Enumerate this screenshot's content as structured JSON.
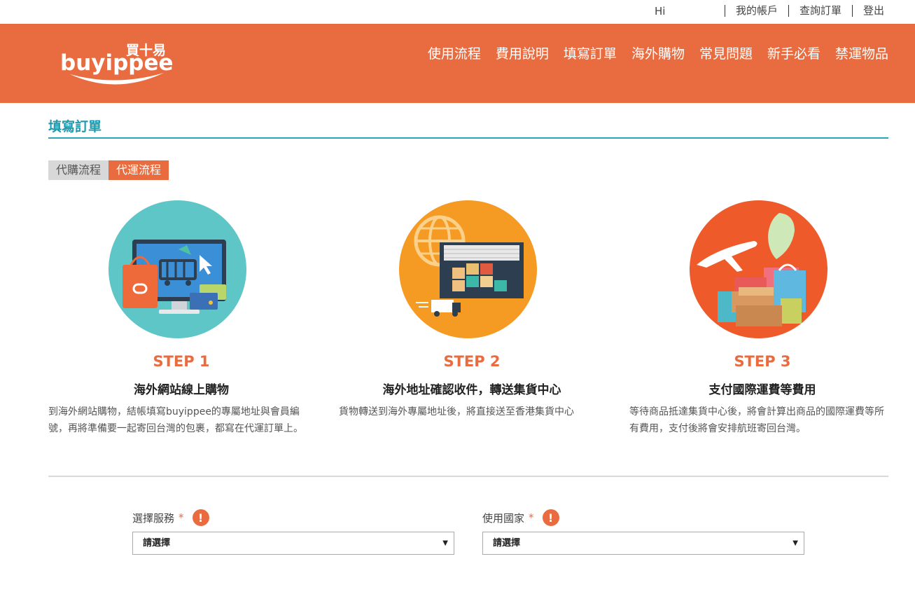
{
  "topbar": {
    "greeting": "Hi",
    "links": [
      "我的帳戶",
      "查詢訂單",
      "登出"
    ]
  },
  "header": {
    "logo_text": "buyippee",
    "logo_cn": "買十易",
    "nav": [
      "使用流程",
      "費用說明",
      "填寫訂單",
      "海外購物",
      "常見問題",
      "新手必看",
      "禁運物品"
    ],
    "bg_color": "#e96c40"
  },
  "page": {
    "title": "填寫訂單",
    "tabs": [
      {
        "label": "代購流程",
        "active": false
      },
      {
        "label": "代運流程",
        "active": true
      }
    ]
  },
  "steps": [
    {
      "number": "STEP 1",
      "title": "海外網站線上購物",
      "desc": "到海外網站購物，結帳填寫buyippee的專屬地址與會員編號，再將準備要一起寄回台灣的包裹，都寫在代運訂單上。",
      "icon": "online-shopping-icon",
      "circle_color": "#5fc6c7"
    },
    {
      "number": "STEP 2",
      "title": "海外地址確認收件，轉送集貨中心",
      "desc": "貨物轉送到海外專屬地址後，將直接送至香港集貨中心",
      "icon": "warehouse-icon",
      "circle_color": "#f59a23"
    },
    {
      "number": "STEP 3",
      "title": "支付國際運費等費用",
      "desc": "等待商品抵達集貨中心後，將會計算出商品的國際運費等所有費用，支付後將會安排航班寄回台灣。",
      "icon": "airplane-icon",
      "circle_color": "#ee5a2a"
    }
  ],
  "form": {
    "service": {
      "label": "選擇服務",
      "required": "*",
      "value": "請選擇"
    },
    "country": {
      "label": "使用國家",
      "required": "*",
      "value": "請選擇"
    },
    "alert_glyph": "!",
    "arrow_glyph": "▼"
  }
}
